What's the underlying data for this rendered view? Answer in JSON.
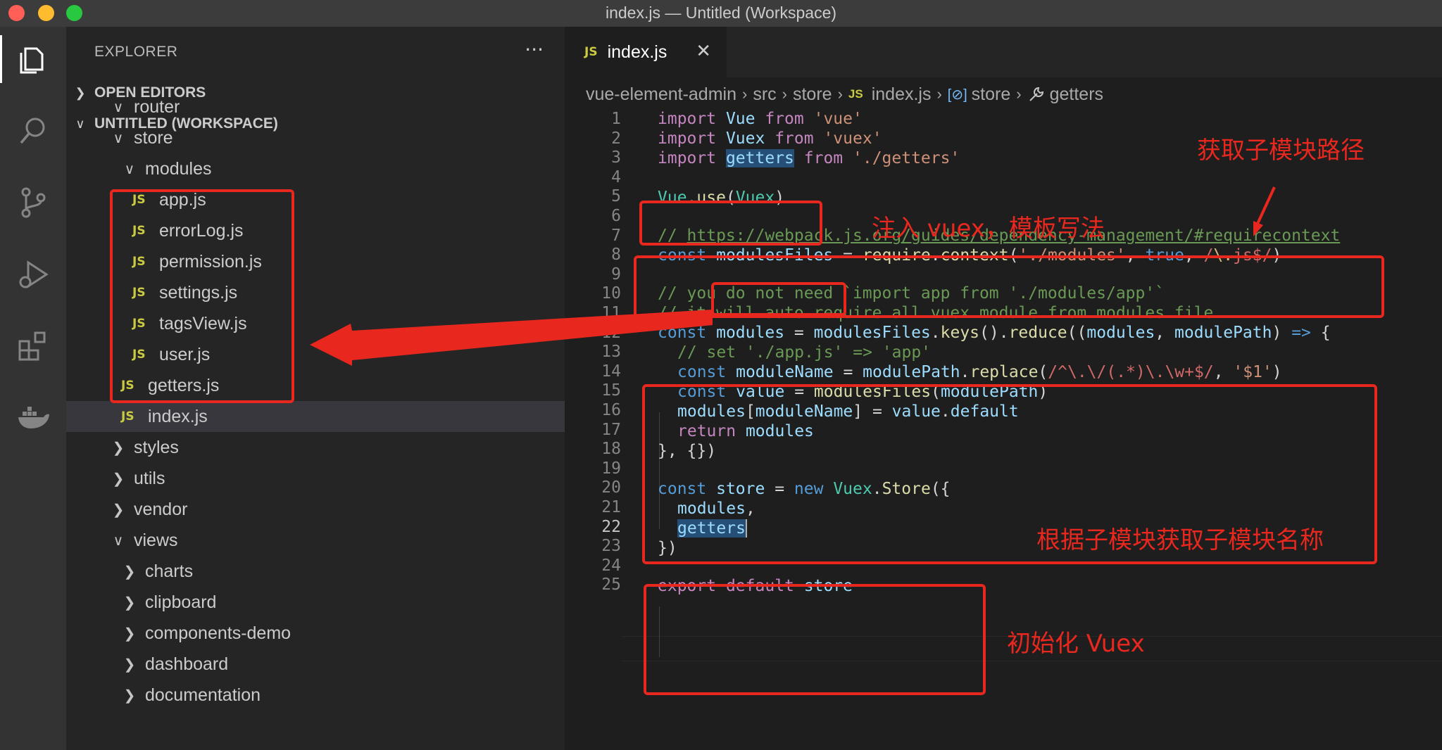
{
  "window": {
    "title": "index.js — Untitled (Workspace)"
  },
  "activity_bar": [
    "files-icon",
    "search-icon",
    "source-control-icon",
    "run-debug-icon",
    "extensions-icon",
    "docker-icon"
  ],
  "explorer": {
    "header": "EXPLORER",
    "more": "···",
    "open_editors": "OPEN EDITORS",
    "workspace": "UNTITLED (WORKSPACE)",
    "tree": [
      {
        "label": "router",
        "type": "folder",
        "depth": 1,
        "open": true
      },
      {
        "label": "store",
        "type": "folder",
        "depth": 1,
        "open": true
      },
      {
        "label": "modules",
        "type": "folder",
        "depth": 2,
        "open": true
      },
      {
        "label": "app.js",
        "type": "file",
        "depth": 3
      },
      {
        "label": "errorLog.js",
        "type": "file",
        "depth": 3
      },
      {
        "label": "permission.js",
        "type": "file",
        "depth": 3
      },
      {
        "label": "settings.js",
        "type": "file",
        "depth": 3
      },
      {
        "label": "tagsView.js",
        "type": "file",
        "depth": 3
      },
      {
        "label": "user.js",
        "type": "file",
        "depth": 3
      },
      {
        "label": "getters.js",
        "type": "file",
        "depth": 2
      },
      {
        "label": "index.js",
        "type": "file",
        "depth": 2,
        "selected": true
      },
      {
        "label": "styles",
        "type": "folder",
        "depth": 1,
        "open": false
      },
      {
        "label": "utils",
        "type": "folder",
        "depth": 1,
        "open": false
      },
      {
        "label": "vendor",
        "type": "folder",
        "depth": 1,
        "open": false
      },
      {
        "label": "views",
        "type": "folder",
        "depth": 1,
        "open": true
      },
      {
        "label": "charts",
        "type": "folder",
        "depth": 2,
        "open": false
      },
      {
        "label": "clipboard",
        "type": "folder",
        "depth": 2,
        "open": false
      },
      {
        "label": "components-demo",
        "type": "folder",
        "depth": 2,
        "open": false
      },
      {
        "label": "dashboard",
        "type": "folder",
        "depth": 2,
        "open": false
      },
      {
        "label": "documentation",
        "type": "folder",
        "depth": 2,
        "open": false
      }
    ]
  },
  "tab": {
    "icon": "JS",
    "label": "index.js",
    "close": "✕"
  },
  "breadcrumbs": {
    "root": "vue-element-admin",
    "src": "src",
    "store": "store",
    "file": "index.js",
    "symbol_icon": "[⊘]",
    "symbol": "store",
    "property": "getters"
  },
  "code_lines": [
    "1",
    "2",
    "3",
    "4",
    "5",
    "6",
    "7",
    "8",
    "9",
    "10",
    "11",
    "12",
    "13",
    "14",
    "15",
    "16",
    "17",
    "18",
    "19",
    "20",
    "21",
    "22",
    "23",
    "24",
    "25"
  ],
  "current_line": "22",
  "code": {
    "l1": {
      "k": "import",
      "a": "Vue",
      "f": "from",
      "s": "'vue'"
    },
    "l2": {
      "k": "import",
      "a": "Vuex",
      "f": "from",
      "s": "'vuex'"
    },
    "l3": {
      "k": "import",
      "a": "getters",
      "f": "from",
      "s": "'./getters'"
    },
    "l5": {
      "a": "Vue",
      "b": ".",
      "c": "use",
      "d": "(",
      "e": "Vuex",
      "g": ")"
    },
    "l7": {
      "c": "// ",
      "u": "https://webpack.js.org/guides/dependency-management/#requirecontext"
    },
    "l8": {
      "k": "const",
      "a": "modulesFiles",
      "b": " = ",
      "c": "require",
      "d": ".",
      "e": "context",
      "f": "(",
      "s": "'./modules'",
      "g": ", ",
      "t": "true",
      "h": ", ",
      "r1": "/",
      "r2": "\\.",
      "r3": "js$",
      "r4": "/",
      "i": ")"
    },
    "l10": "// you do not need `import app from './modules/app'`",
    "l11": "// it will auto require all vuex module from modules file",
    "l12": {
      "k": "const",
      "a": "modules",
      "b": " = ",
      "c": "modulesFiles",
      "d": ".",
      "e": "keys",
      "f": "().",
      "g": "reduce",
      "h": "((",
      "i": "modules",
      "j": ", ",
      "m": "modulePath",
      "n": ") ",
      "o": "=>",
      "p": " {"
    },
    "l13": "// set './app.js' => 'app'",
    "l14": {
      "k": "const",
      "a": "moduleName",
      "b": " = ",
      "c": "modulePath",
      "d": ".",
      "e": "replace",
      "f": "(",
      "r": "/^\\.\\/(.*)\\.\\w+$/",
      "g": ", ",
      "s": "'$1'",
      "h": ")"
    },
    "l15": {
      "k": "const",
      "a": "value",
      "b": " = ",
      "c": "modulesFiles",
      "d": "(",
      "e": "modulePath",
      "f": ")"
    },
    "l16": {
      "a": "modules",
      "b": "[",
      "c": "moduleName",
      "d": "] = ",
      "e": "value",
      "f": ".",
      "g": "default"
    },
    "l17": {
      "k": "return",
      "a": "modules"
    },
    "l18": "}, {})",
    "l20": {
      "k": "const",
      "a": "store",
      "b": " = ",
      "n": "new",
      "c": "Vuex",
      "d": ".",
      "e": "Store",
      "f": "({"
    },
    "l21": {
      "a": "modules",
      "b": ","
    },
    "l22": {
      "a": "getters"
    },
    "l23": "})",
    "l25": {
      "k": "export",
      "d": "default",
      "a": "store"
    }
  },
  "annotations": {
    "path": "获取子模块路径",
    "inject": "注入 vuex，模板写法",
    "name": "根据子模块获取子模块名称",
    "init": "初始化 Vuex"
  },
  "colors": {
    "annotation": "#e8281e",
    "accent": "#007acc"
  }
}
